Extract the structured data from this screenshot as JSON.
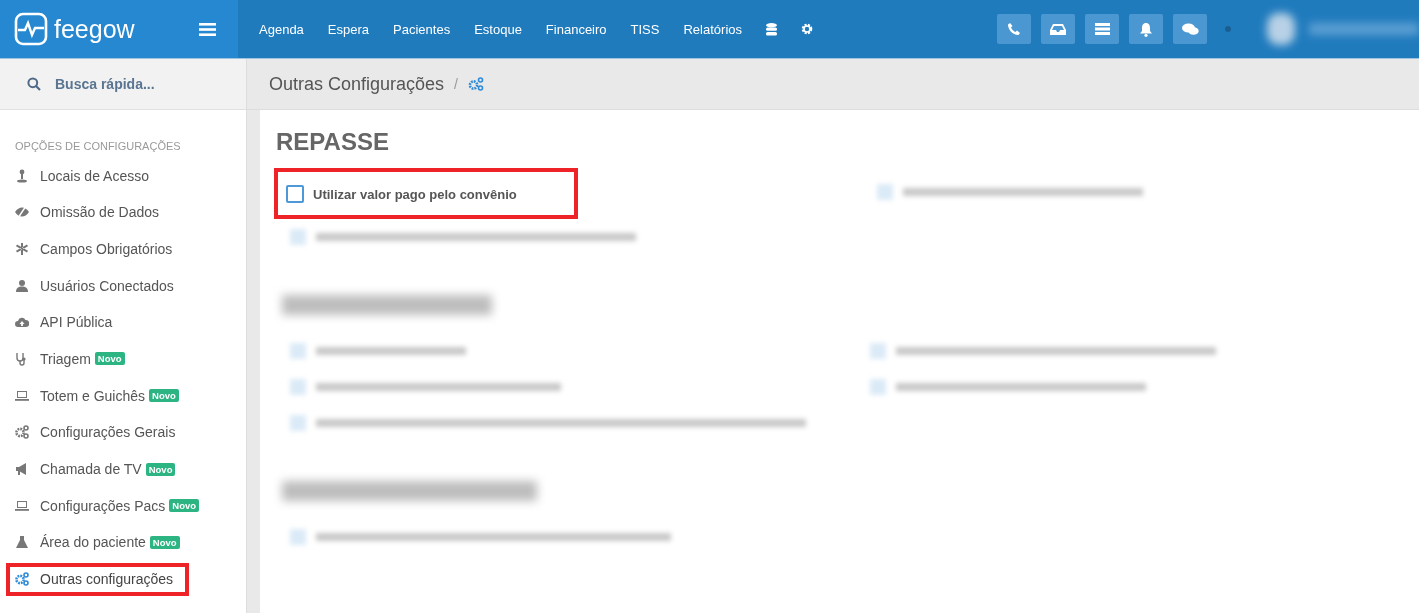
{
  "brand": {
    "name": "feegow"
  },
  "nav": [
    {
      "label": "Agenda"
    },
    {
      "label": "Espera"
    },
    {
      "label": "Pacientes"
    },
    {
      "label": "Estoque"
    },
    {
      "label": "Financeiro"
    },
    {
      "label": "TISS"
    },
    {
      "label": "Relatórios"
    }
  ],
  "search": {
    "placeholder": "Busca rápida..."
  },
  "breadcrumb": {
    "title": "Outras Configurações",
    "separator": "/"
  },
  "sidebar": {
    "heading": "OPÇÕES DE CONFIGURAÇÕES",
    "items": [
      {
        "label": "Locais de Acesso",
        "selected": false,
        "highlighted": false
      },
      {
        "label": "Omissão de Dados",
        "selected": false,
        "highlighted": false
      },
      {
        "label": "Campos Obrigatórios",
        "selected": false,
        "highlighted": false
      },
      {
        "label": "Usuários Conectados",
        "selected": false,
        "highlighted": false
      },
      {
        "label": "API Pública",
        "selected": false,
        "highlighted": false
      },
      {
        "label": "Triagem",
        "badge": "Novo",
        "selected": false,
        "highlighted": false
      },
      {
        "label": "Totem e Guichês",
        "badge": "Novo",
        "selected": false,
        "highlighted": false
      },
      {
        "label": "Configurações Gerais",
        "selected": false,
        "highlighted": false
      },
      {
        "label": "Chamada de TV",
        "badge": "Novo",
        "selected": false,
        "highlighted": false
      },
      {
        "label": "Configurações Pacs",
        "badge": "Novo",
        "selected": false,
        "highlighted": false
      },
      {
        "label": "Área do paciente",
        "badge": "Novo",
        "selected": false,
        "highlighted": false
      },
      {
        "label": "Outras configurações",
        "selected": true,
        "highlighted": true
      }
    ]
  },
  "section": {
    "title": "REPASSE",
    "option": {
      "label": "Utilizar valor pago pelo convênio",
      "checked": false,
      "highlighted": true
    }
  }
}
